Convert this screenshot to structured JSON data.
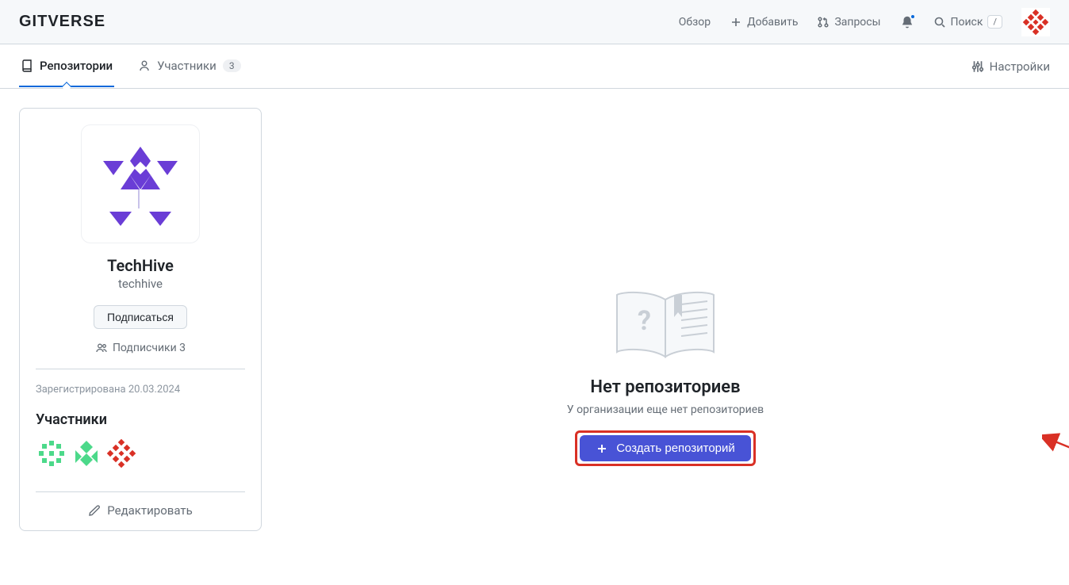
{
  "brand": "GITVERSE",
  "header": {
    "overview": "Обзор",
    "add": "Добавить",
    "requests": "Запросы",
    "search": "Поиск",
    "search_key": "/"
  },
  "tabs": {
    "repos": "Репозитории",
    "members": "Участники",
    "members_count": "3",
    "settings": "Настройки"
  },
  "org": {
    "name": "TechHive",
    "handle": "techhive",
    "subscribe": "Подписаться",
    "followers_label": "Подписчики 3",
    "registered": "Зарегистрирована 20.03.2024",
    "members_title": "Участники",
    "edit": "Редактировать"
  },
  "empty": {
    "title": "Нет репозиториев",
    "subtitle": "У организации еще нет репозиториев",
    "create": "Создать репозиторий"
  }
}
